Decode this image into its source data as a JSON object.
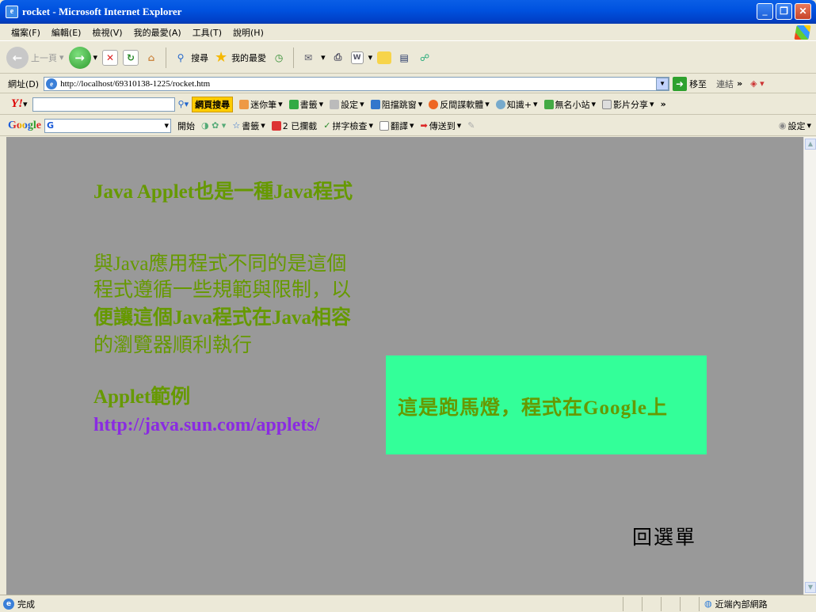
{
  "window": {
    "title": "rocket - Microsoft Internet Explorer"
  },
  "menubar": {
    "items": [
      "檔案(F)",
      "編輯(E)",
      "檢視(V)",
      "我的最愛(A)",
      "工具(T)",
      "說明(H)"
    ]
  },
  "toolbar": {
    "back_label": "上一頁",
    "search_label": "搜尋",
    "favorites_label": "我的最愛"
  },
  "addressbar": {
    "label": "網址(D)",
    "url": "http://localhost/69310138-1225/rocket.htm",
    "go_label": "移至",
    "links_label": "連結",
    "more": "»"
  },
  "yahoo": {
    "logo": "Y!",
    "search_button": "網頁搜尋",
    "items": [
      "迷你筆",
      "書籤",
      "設定",
      "阻擋跳窗",
      "反間諜軟體",
      "知識+",
      "無名小站",
      "影片分享"
    ],
    "more": "»"
  },
  "google": {
    "logo": "Google",
    "search_value": "G",
    "go_label": "開始",
    "items": [
      "書籤",
      "2 已攔截",
      "拼字檢查",
      "翻譯",
      "傳送到"
    ],
    "settings": "設定"
  },
  "page": {
    "line1": "Java Applet也是一種Java程式",
    "para": [
      "與Java應用程式不同的是這個",
      "程式遵循一些規範與限制，以",
      "便讓這個Java程式在Java相容",
      "的瀏覽器順利執行"
    ],
    "example_label": "Applet範例",
    "example_link": "http://java.sun.com/applets/",
    "marquee_text": "這是跑馬燈，程式在Google上",
    "menu_link": "回選單"
  },
  "status": {
    "text": "完成",
    "zone": "近端內部網路"
  },
  "colors": {
    "page_bg": "#999999",
    "text_green": "#669900",
    "link": "#8a2be2",
    "marquee_bg": "#33ff99"
  }
}
